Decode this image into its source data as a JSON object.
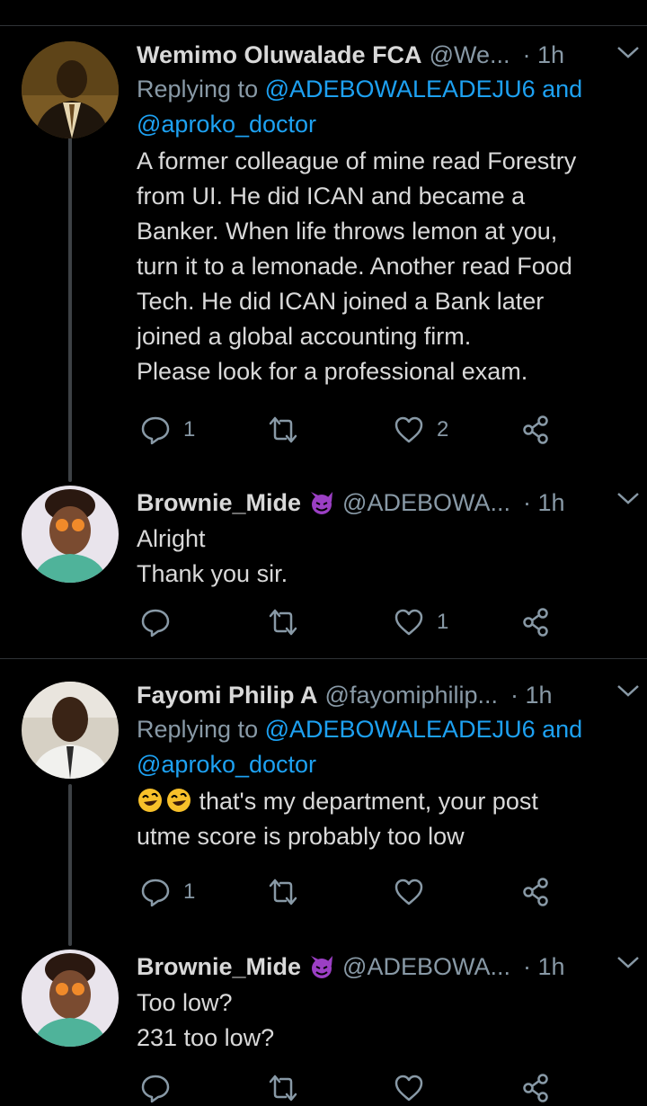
{
  "tweets": [
    {
      "name": "Wemimo Oluwalade FCA",
      "handle": "@We...",
      "time": "1h",
      "replying_prefix": "Replying to",
      "mention1": "@ADEBOWALEADEJU6",
      "and_text": "and",
      "mention2": "@aproko_doctor",
      "body_lines": [
        "A former colleague of mine read Forestry",
        "from UI. He did ICAN and became a",
        "Banker. When life throws lemon at you,",
        "turn it to a lemonade. Another read Food",
        "Tech. He did ICAN joined a Bank later",
        "joined a global accounting firm.",
        "Please look for a professional exam."
      ],
      "reply_count": "1",
      "retweet_count": "",
      "like_count": "2"
    },
    {
      "name": "Brownie_Mide",
      "handle": "@ADEBOWA...",
      "time": "1h",
      "body_lines": [
        "Alright",
        "Thank you sir."
      ],
      "reply_count": "",
      "retweet_count": "",
      "like_count": "1"
    },
    {
      "name": "Fayomi Philip A",
      "handle": "@fayomiphilip...",
      "time": "1h",
      "replying_prefix": "Replying to",
      "mention1": "@ADEBOWALEADEJU6",
      "and_text": "and",
      "mention2": "@aproko_doctor",
      "body_lines": [
        "that's my department, your post",
        "utme score is probably too low"
      ],
      "reply_count": "1",
      "retweet_count": "",
      "like_count": ""
    },
    {
      "name": "Brownie_Mide",
      "handle": "@ADEBOWA...",
      "time": "1h",
      "body_lines": [
        "Too low?",
        "231 too low?"
      ]
    }
  ],
  "time_separator": "·",
  "colors": {
    "background": "#000000",
    "text": "#d9d9d9",
    "muted": "#8899a6",
    "link": "#1da1f2",
    "thread_line": "#3d4145"
  },
  "icons": [
    "reply-icon",
    "retweet-icon",
    "like-icon",
    "share-icon",
    "chevron-down-icon",
    "devil-emoji-icon",
    "rofl-emoji-icon"
  ]
}
